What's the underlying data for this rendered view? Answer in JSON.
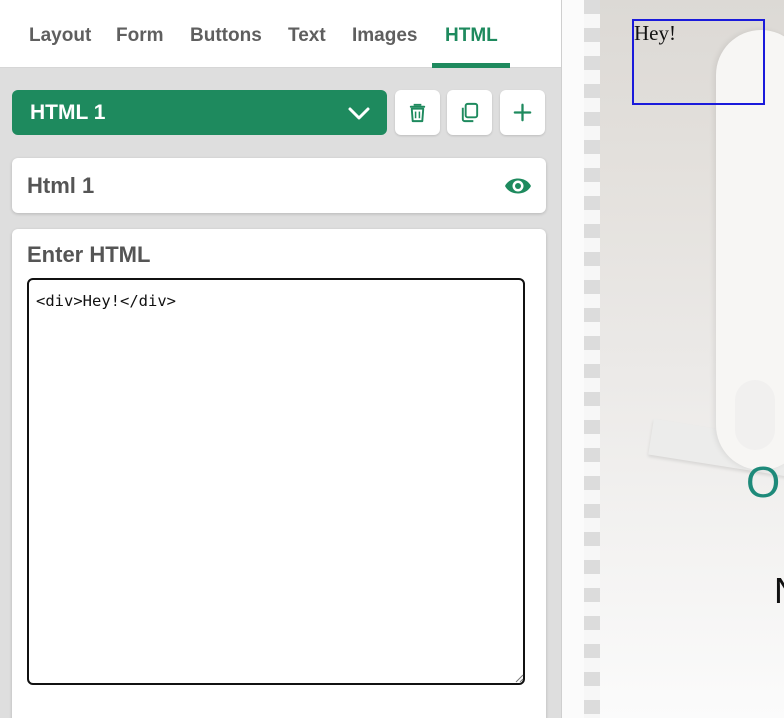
{
  "tabs": [
    {
      "label": "Layout"
    },
    {
      "label": "Form"
    },
    {
      "label": "Buttons"
    },
    {
      "label": "Text"
    },
    {
      "label": "Images"
    },
    {
      "label": "HTML",
      "active": true
    }
  ],
  "element_select": {
    "selected": "HTML 1"
  },
  "toolbar": {
    "delete_icon": "trash-icon",
    "duplicate_icon": "copy-icon",
    "add_icon": "plus-icon"
  },
  "element_name": {
    "title": "Html 1",
    "visibility_icon": "eye-icon"
  },
  "html_editor": {
    "label": "Enter HTML",
    "value": "<div>Hey!</div>"
  },
  "preview": {
    "rendered_text": "Hey!",
    "partial_letters": [
      "O",
      "N"
    ]
  },
  "colors": {
    "accent": "#1e8a5e",
    "selection_border": "#1a1adb",
    "panel_bg": "#dedede"
  }
}
